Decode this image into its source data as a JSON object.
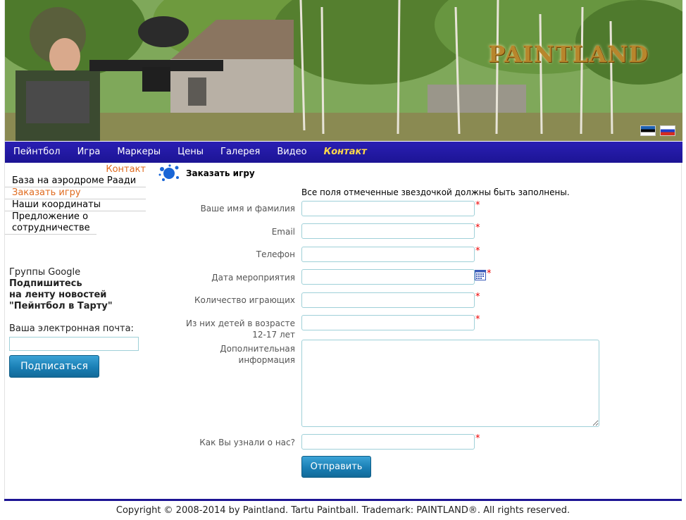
{
  "header": {
    "logo_text": "PAINTLAND",
    "flags": [
      "estonian-flag",
      "russian-flag"
    ]
  },
  "nav": {
    "items": [
      "Пейнтбол",
      "Игра",
      "Маркеры",
      "Цены",
      "Галерея",
      "Видео",
      "Контакт"
    ],
    "active_index": 6
  },
  "sidebar": {
    "title": "Контакт",
    "items": [
      "База на аэродроме Раади",
      "Заказать игру",
      "Наши координаты",
      "Предложение о сотрудничестве"
    ],
    "active_index": 1
  },
  "subscribe": {
    "group_label": "Группы Google",
    "line1": "Подпишитесь",
    "line2": "на ленту новостей",
    "line3": "\"Пейнтбол в Тарту\"",
    "email_label": "Ваша электронная почта:",
    "email_value": "",
    "button": "Подписаться"
  },
  "form": {
    "title": "Заказать игру",
    "note": "Все поля отмеченные звездочкой должны быть заполнены.",
    "name_label": "Ваше имя и фамилия",
    "email_label": "Email",
    "phone_label": "Телефон",
    "date_label": "Дата мероприятия",
    "players_label": "Количество играющих",
    "kids_label_1": "Из них детей в возрасте",
    "kids_label_2": "12-17 лет",
    "extra_label_1": "Дополнительная",
    "extra_label_2": "информация",
    "source_label": "Как Вы узнали о нас?",
    "required_mark": "*",
    "submit": "Отправить"
  },
  "colors": {
    "nav_bg": "#1c1494",
    "nav_active": "#ffd84a",
    "accent_orange": "#e06b1f",
    "button_blue": "#1a7fb5"
  },
  "footer": {
    "text": "Copyright © 2008-2014 by Paintland. Tartu Paintball. Trademark: PAINTLAND®. All rights reserved."
  }
}
